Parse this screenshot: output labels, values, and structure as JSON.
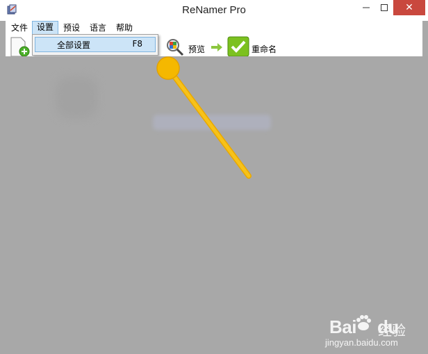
{
  "window": {
    "title": "ReNamer Pro",
    "close_glyph": "✕"
  },
  "menubar": {
    "items": [
      {
        "label": "文件"
      },
      {
        "label": "设置"
      },
      {
        "label": "预设"
      },
      {
        "label": "语言"
      },
      {
        "label": "帮助"
      }
    ],
    "active_index": 1
  },
  "dropdown": {
    "item_label": "全部设置",
    "item_shortcut": "F8"
  },
  "toolbar": {
    "preview_label": "预览",
    "rename_label": "重命名"
  },
  "icons": {
    "app": "app-icon",
    "add_file": "add-file-icon",
    "preview": "magnifier-icon",
    "arrow": "arrow-right-icon",
    "rename": "checkmark-icon"
  },
  "colors": {
    "accent_highlight": "#cce4f7",
    "close_button": "#c9483e",
    "annotation": "#f5b800",
    "overlay": "#a8a8a8"
  },
  "watermark": {
    "brand": "Bai",
    "brand_suffix": "du",
    "cn": "经验",
    "url": "jingyan.baidu.com"
  }
}
